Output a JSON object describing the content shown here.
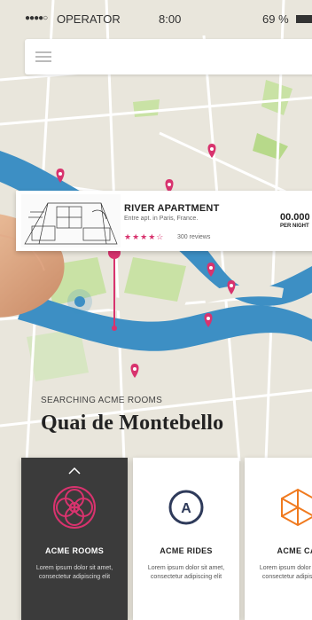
{
  "status": {
    "signal": "●●●●○",
    "carrier": "OPERATOR",
    "time": "8:00",
    "battery": "69 %"
  },
  "listing": {
    "title": "RIVER APARTMENT",
    "subtitle": "Entre apt. in Paris, France.",
    "stars": "★★★★☆",
    "rating": 4,
    "reviews": "300 reviews",
    "price": "00.000",
    "price_unit": "PER NIGHT"
  },
  "search": {
    "label": "SEARCHING ACME ROOMS",
    "location": "Quai de Montebello"
  },
  "cards": [
    {
      "title": "ACME ROOMS",
      "desc": "Lorem ipsum dolor sit amet, consectetur adipiscing elit",
      "icon": "rooms-flower-icon",
      "active": true
    },
    {
      "title": "ACME RIDES",
      "desc": "Lorem ipsum dolor sit amet, consectetur adipiscing elit",
      "icon": "rides-a-icon",
      "active": false
    },
    {
      "title": "ACME CAI",
      "desc": "Lorem ipsum dolor sit amet, consectetur adipiscing elit",
      "icon": "cai-polygon-icon",
      "active": false
    }
  ],
  "colors": {
    "accent": "#d8336e",
    "river": "#3d8fc4",
    "map_bg": "#e9e6dc",
    "park": "#b7d98a",
    "active_card": "#3b3b3b",
    "orange": "#f07a1f",
    "navy": "#2e3a5a"
  }
}
